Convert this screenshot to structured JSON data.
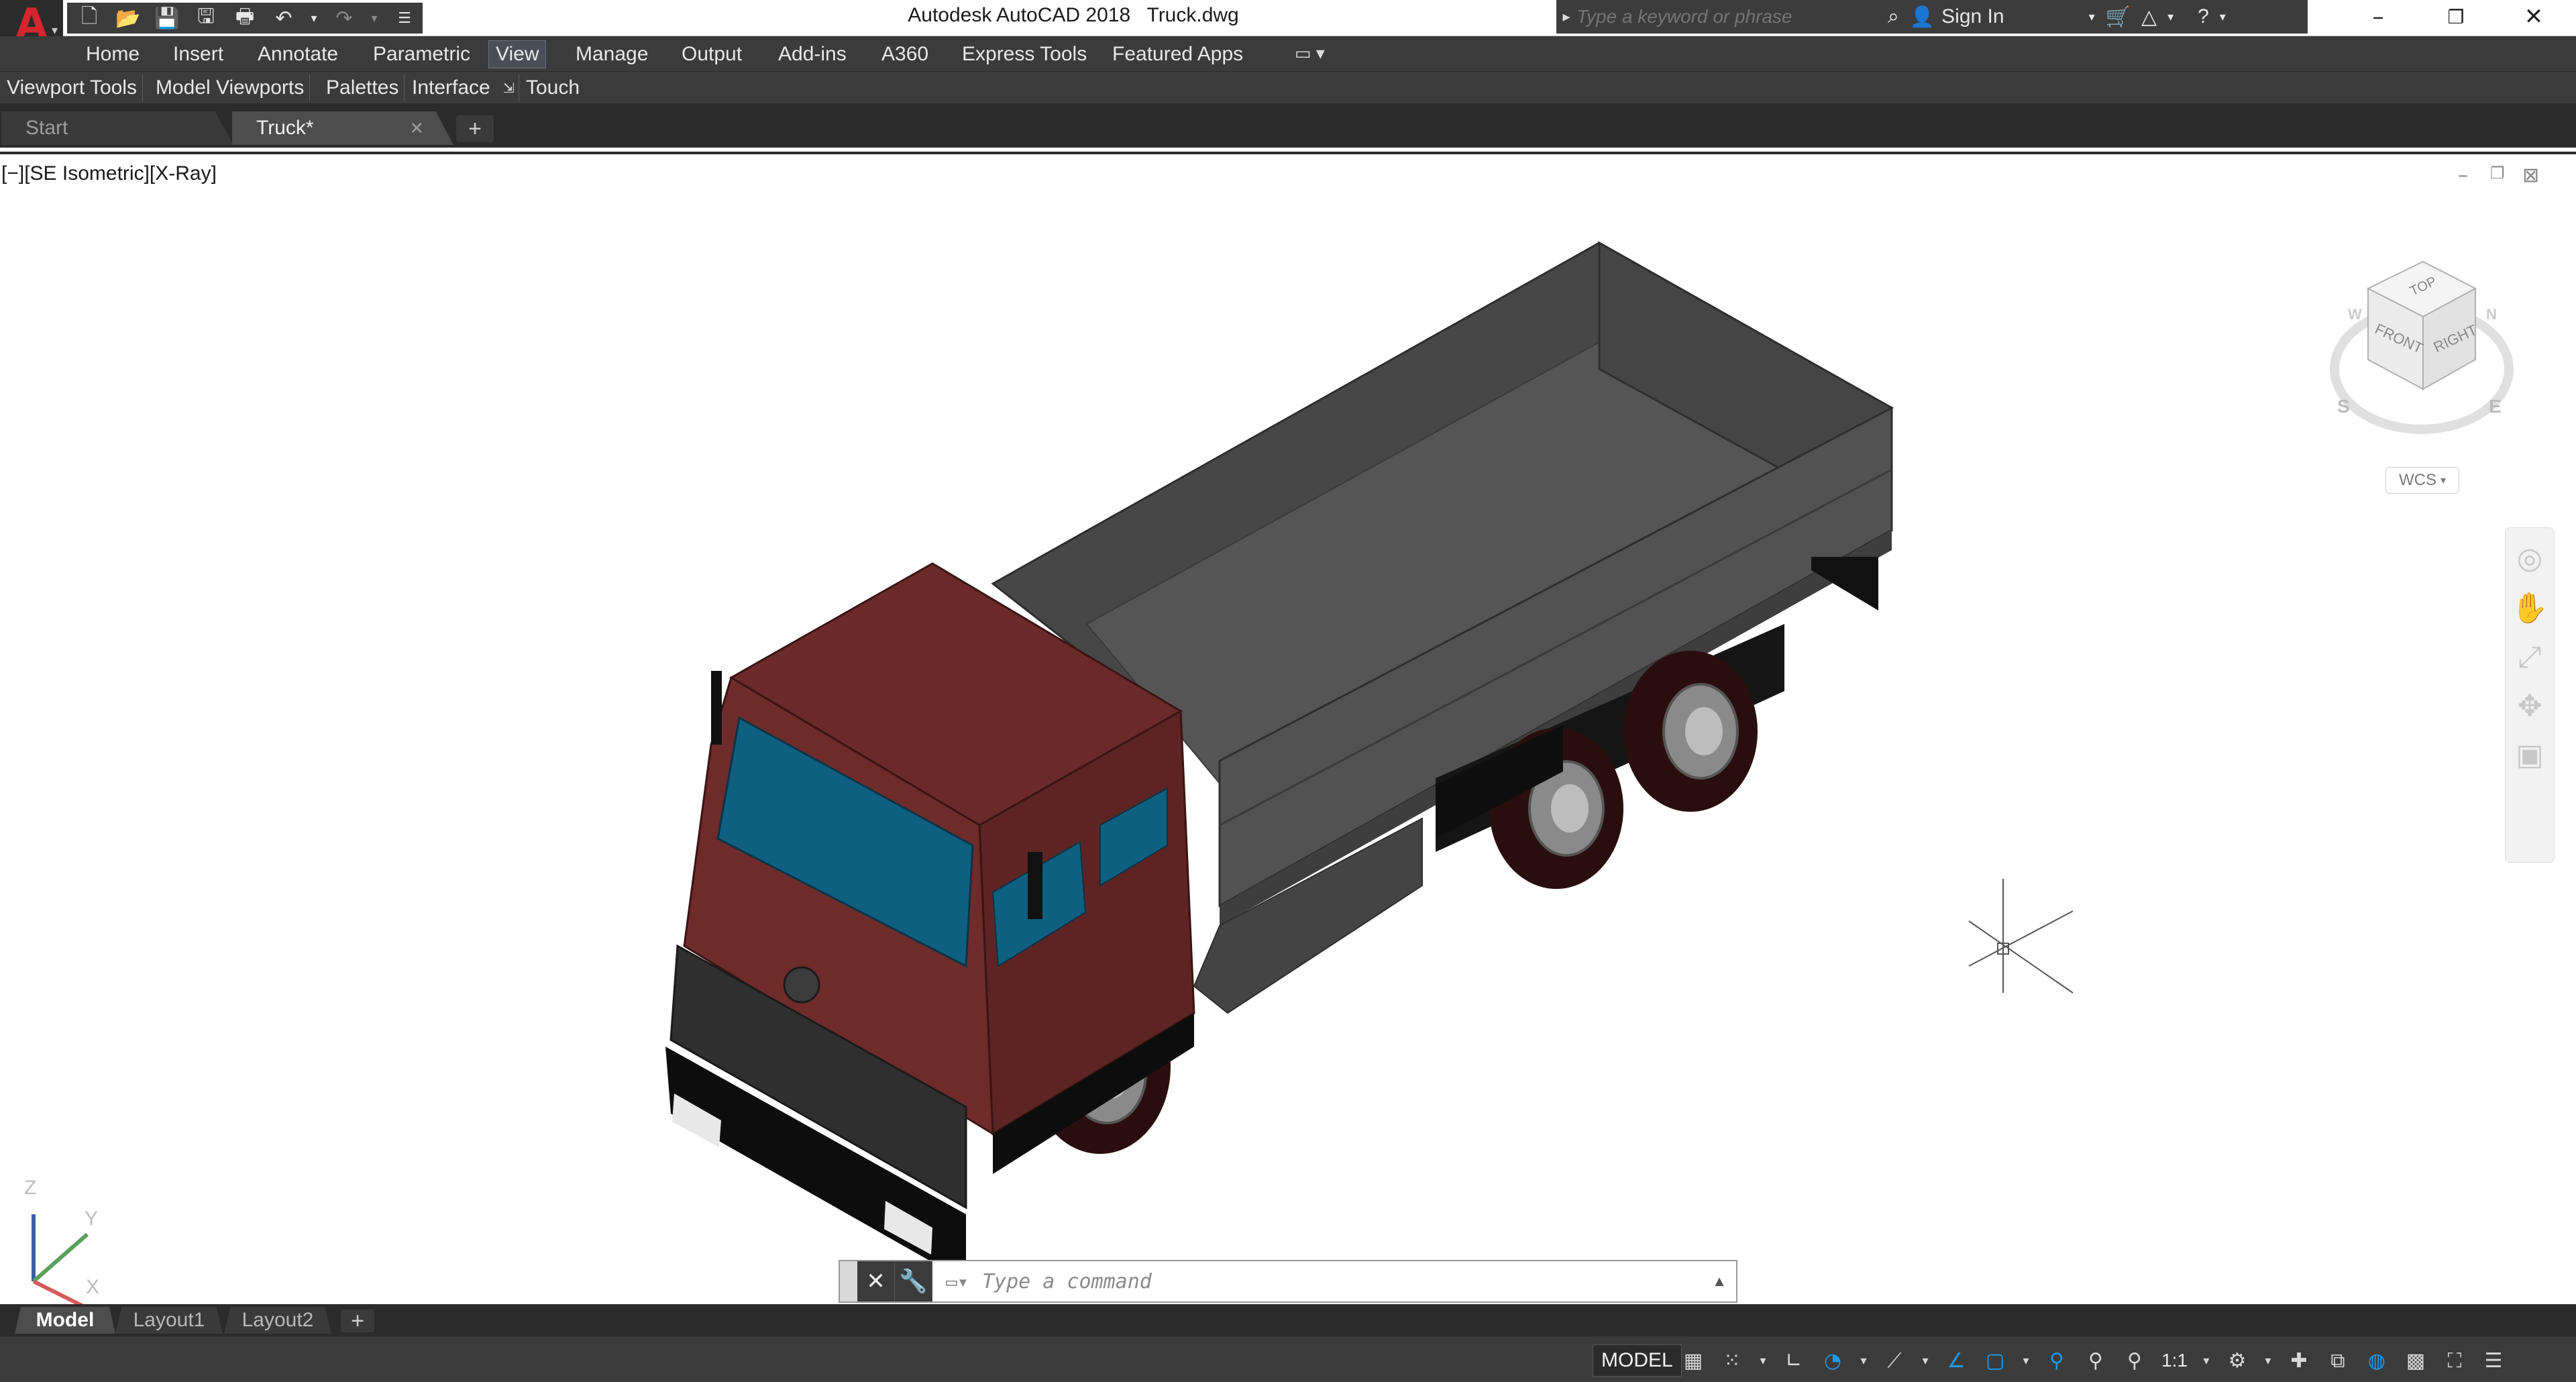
{
  "app": {
    "title_app": "Autodesk AutoCAD 2018",
    "title_file": "Truck.dwg",
    "logo_letter": "A",
    "colors": {
      "accent_red": "#d4262d",
      "ribbon_bg": "#3b3b3b",
      "cab_color": "#6b2a29",
      "glass_color": "#0f5f80",
      "bed_color": "#5a5a5a",
      "status_blue": "#1e9bf0"
    }
  },
  "quick_access": {
    "icons": [
      "new-icon",
      "open-icon",
      "save-icon",
      "save-as-icon",
      "plot-icon",
      "undo-icon",
      "undo-dropdown-icon",
      "redo-icon",
      "redo-dropdown-icon",
      "customize-dropdown-icon"
    ]
  },
  "search": {
    "placeholder": "Type a keyword or phrase"
  },
  "account": {
    "sign_in": "Sign In"
  },
  "ribbon": {
    "tabs": [
      "Home",
      "Insert",
      "Annotate",
      "Parametric",
      "View",
      "Manage",
      "Output",
      "Add-ins",
      "A360",
      "Express Tools",
      "Featured Apps"
    ],
    "active_tab": "View",
    "panels": [
      "Viewport Tools",
      "Model Viewports",
      "Palettes",
      "Interface",
      "Touch"
    ]
  },
  "file_tabs": {
    "tabs": [
      {
        "label": "Start",
        "active": false
      },
      {
        "label": "Truck*",
        "active": true
      }
    ],
    "close_glyph": "✕",
    "add_glyph": "+"
  },
  "viewport": {
    "label": "[−][SE Isometric][X-Ray]",
    "viewcube": {
      "top": "TOP",
      "front": "FRONT",
      "right": "RIGHT",
      "compass_s": "S",
      "compass_e": "E",
      "compass_w": "W",
      "compass_n": "N"
    },
    "wcs": "WCS",
    "ucs": {
      "x": "X",
      "y": "Y",
      "z": "Z"
    }
  },
  "command_line": {
    "placeholder": "Type a command"
  },
  "layout_tabs": {
    "tabs": [
      {
        "label": "Model",
        "active": true
      },
      {
        "label": "Layout1",
        "active": false
      },
      {
        "label": "Layout2",
        "active": false
      }
    ],
    "add_glyph": "+"
  },
  "status_bar": {
    "model_label": "MODEL",
    "scale": "1:1"
  }
}
